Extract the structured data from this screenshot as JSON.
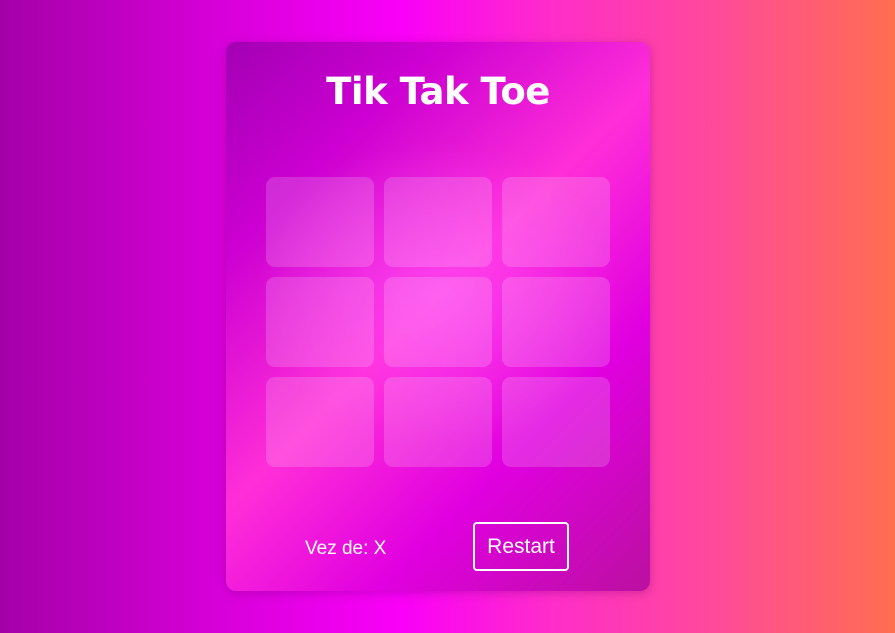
{
  "game": {
    "title": "Tik Tak Toe",
    "board": [
      "",
      "",
      "",
      "",
      "",
      "",
      "",
      "",
      ""
    ],
    "status_label": "Vez de:",
    "current_player": "X",
    "restart_label": "Restart"
  }
}
